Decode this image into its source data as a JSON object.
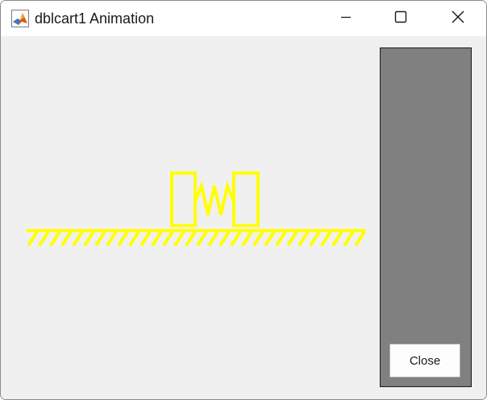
{
  "window": {
    "title": "dblcart1 Animation",
    "app_icon": "matlab-icon",
    "controls": {
      "minimize_icon": "minimize-icon",
      "maximize_icon": "maximize-icon",
      "close_icon": "close-icon"
    }
  },
  "animation": {
    "stroke_color": "#ffff00",
    "background_color": "#f0f0f0",
    "cart_left": "cart-left",
    "cart_right": "cart-right",
    "spring": "spring",
    "ground": "ground-hatch"
  },
  "panel": {
    "background_color": "#808080",
    "close_button_label": "Close"
  }
}
